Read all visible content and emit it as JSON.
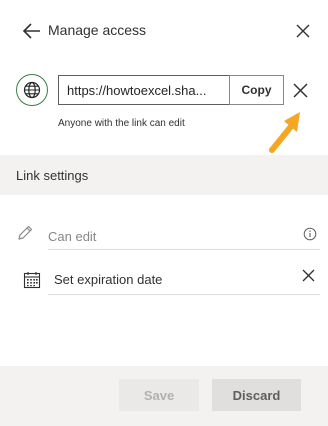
{
  "header": {
    "title": "Manage access",
    "back_icon": "back-arrow-icon",
    "close_icon": "close-icon"
  },
  "link": {
    "url": "https://howtoexcel.sha...",
    "copy_label": "Copy",
    "permission_text": "Anyone with the link can edit",
    "globe_icon": "globe-icon",
    "remove_icon": "close-icon"
  },
  "annotation": {
    "arrow_icon": "arrow-icon",
    "color": "#f5a623"
  },
  "settings": {
    "section_label": "Link settings",
    "permission_placeholder": "Can edit",
    "expiration_label": "Set expiration date"
  },
  "footer": {
    "save_label": "Save",
    "discard_label": "Discard"
  },
  "colors": {
    "globe_accent": "#3a7d44",
    "band": "#f3f2f1"
  }
}
